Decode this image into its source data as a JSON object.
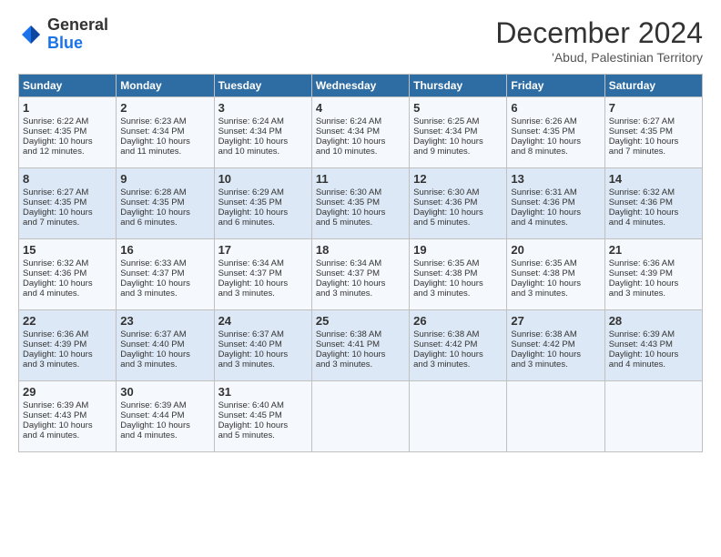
{
  "logo": {
    "general": "General",
    "blue": "Blue"
  },
  "title": "December 2024",
  "subtitle": "'Abud, Palestinian Territory",
  "days_of_week": [
    "Sunday",
    "Monday",
    "Tuesday",
    "Wednesday",
    "Thursday",
    "Friday",
    "Saturday"
  ],
  "weeks": [
    [
      {
        "day": 1,
        "lines": [
          "Sunrise: 6:22 AM",
          "Sunset: 4:35 PM",
          "Daylight: 10 hours",
          "and 12 minutes."
        ]
      },
      {
        "day": 2,
        "lines": [
          "Sunrise: 6:23 AM",
          "Sunset: 4:34 PM",
          "Daylight: 10 hours",
          "and 11 minutes."
        ]
      },
      {
        "day": 3,
        "lines": [
          "Sunrise: 6:24 AM",
          "Sunset: 4:34 PM",
          "Daylight: 10 hours",
          "and 10 minutes."
        ]
      },
      {
        "day": 4,
        "lines": [
          "Sunrise: 6:24 AM",
          "Sunset: 4:34 PM",
          "Daylight: 10 hours",
          "and 10 minutes."
        ]
      },
      {
        "day": 5,
        "lines": [
          "Sunrise: 6:25 AM",
          "Sunset: 4:34 PM",
          "Daylight: 10 hours",
          "and 9 minutes."
        ]
      },
      {
        "day": 6,
        "lines": [
          "Sunrise: 6:26 AM",
          "Sunset: 4:35 PM",
          "Daylight: 10 hours",
          "and 8 minutes."
        ]
      },
      {
        "day": 7,
        "lines": [
          "Sunrise: 6:27 AM",
          "Sunset: 4:35 PM",
          "Daylight: 10 hours",
          "and 7 minutes."
        ]
      }
    ],
    [
      {
        "day": 8,
        "lines": [
          "Sunrise: 6:27 AM",
          "Sunset: 4:35 PM",
          "Daylight: 10 hours",
          "and 7 minutes."
        ]
      },
      {
        "day": 9,
        "lines": [
          "Sunrise: 6:28 AM",
          "Sunset: 4:35 PM",
          "Daylight: 10 hours",
          "and 6 minutes."
        ]
      },
      {
        "day": 10,
        "lines": [
          "Sunrise: 6:29 AM",
          "Sunset: 4:35 PM",
          "Daylight: 10 hours",
          "and 6 minutes."
        ]
      },
      {
        "day": 11,
        "lines": [
          "Sunrise: 6:30 AM",
          "Sunset: 4:35 PM",
          "Daylight: 10 hours",
          "and 5 minutes."
        ]
      },
      {
        "day": 12,
        "lines": [
          "Sunrise: 6:30 AM",
          "Sunset: 4:36 PM",
          "Daylight: 10 hours",
          "and 5 minutes."
        ]
      },
      {
        "day": 13,
        "lines": [
          "Sunrise: 6:31 AM",
          "Sunset: 4:36 PM",
          "Daylight: 10 hours",
          "and 4 minutes."
        ]
      },
      {
        "day": 14,
        "lines": [
          "Sunrise: 6:32 AM",
          "Sunset: 4:36 PM",
          "Daylight: 10 hours",
          "and 4 minutes."
        ]
      }
    ],
    [
      {
        "day": 15,
        "lines": [
          "Sunrise: 6:32 AM",
          "Sunset: 4:36 PM",
          "Daylight: 10 hours",
          "and 4 minutes."
        ]
      },
      {
        "day": 16,
        "lines": [
          "Sunrise: 6:33 AM",
          "Sunset: 4:37 PM",
          "Daylight: 10 hours",
          "and 3 minutes."
        ]
      },
      {
        "day": 17,
        "lines": [
          "Sunrise: 6:34 AM",
          "Sunset: 4:37 PM",
          "Daylight: 10 hours",
          "and 3 minutes."
        ]
      },
      {
        "day": 18,
        "lines": [
          "Sunrise: 6:34 AM",
          "Sunset: 4:37 PM",
          "Daylight: 10 hours",
          "and 3 minutes."
        ]
      },
      {
        "day": 19,
        "lines": [
          "Sunrise: 6:35 AM",
          "Sunset: 4:38 PM",
          "Daylight: 10 hours",
          "and 3 minutes."
        ]
      },
      {
        "day": 20,
        "lines": [
          "Sunrise: 6:35 AM",
          "Sunset: 4:38 PM",
          "Daylight: 10 hours",
          "and 3 minutes."
        ]
      },
      {
        "day": 21,
        "lines": [
          "Sunrise: 6:36 AM",
          "Sunset: 4:39 PM",
          "Daylight: 10 hours",
          "and 3 minutes."
        ]
      }
    ],
    [
      {
        "day": 22,
        "lines": [
          "Sunrise: 6:36 AM",
          "Sunset: 4:39 PM",
          "Daylight: 10 hours",
          "and 3 minutes."
        ]
      },
      {
        "day": 23,
        "lines": [
          "Sunrise: 6:37 AM",
          "Sunset: 4:40 PM",
          "Daylight: 10 hours",
          "and 3 minutes."
        ]
      },
      {
        "day": 24,
        "lines": [
          "Sunrise: 6:37 AM",
          "Sunset: 4:40 PM",
          "Daylight: 10 hours",
          "and 3 minutes."
        ]
      },
      {
        "day": 25,
        "lines": [
          "Sunrise: 6:38 AM",
          "Sunset: 4:41 PM",
          "Daylight: 10 hours",
          "and 3 minutes."
        ]
      },
      {
        "day": 26,
        "lines": [
          "Sunrise: 6:38 AM",
          "Sunset: 4:42 PM",
          "Daylight: 10 hours",
          "and 3 minutes."
        ]
      },
      {
        "day": 27,
        "lines": [
          "Sunrise: 6:38 AM",
          "Sunset: 4:42 PM",
          "Daylight: 10 hours",
          "and 3 minutes."
        ]
      },
      {
        "day": 28,
        "lines": [
          "Sunrise: 6:39 AM",
          "Sunset: 4:43 PM",
          "Daylight: 10 hours",
          "and 4 minutes."
        ]
      }
    ],
    [
      {
        "day": 29,
        "lines": [
          "Sunrise: 6:39 AM",
          "Sunset: 4:43 PM",
          "Daylight: 10 hours",
          "and 4 minutes."
        ]
      },
      {
        "day": 30,
        "lines": [
          "Sunrise: 6:39 AM",
          "Sunset: 4:44 PM",
          "Daylight: 10 hours",
          "and 4 minutes."
        ]
      },
      {
        "day": 31,
        "lines": [
          "Sunrise: 6:40 AM",
          "Sunset: 4:45 PM",
          "Daylight: 10 hours",
          "and 5 minutes."
        ]
      },
      null,
      null,
      null,
      null
    ]
  ]
}
